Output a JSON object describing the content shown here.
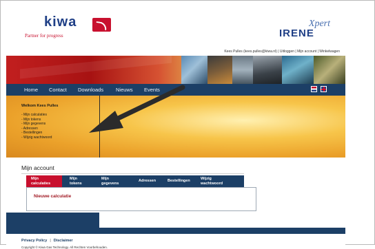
{
  "header": {
    "logo_text": "kiwa",
    "tagline": "Partner for progress",
    "product_superscript": "Xpert",
    "product_name": "IRENE",
    "user_bar": "Kees Pulles (kees.pulles@kiwa.nl) | Uitloggen | Mijn account | Winkelwagen"
  },
  "nav": {
    "items": [
      "Home",
      "Contact",
      "Downloads",
      "Nieuws",
      "Events"
    ],
    "flags": [
      "flag-nl-icon",
      "flag-uk-icon"
    ]
  },
  "sidebar": {
    "welcome": "Welkom Kees Pulles",
    "links": [
      "- Mijn calculaties",
      "- Mijn tokens",
      "- Mijn gegevens",
      "- Adressen",
      "- Bestellingen",
      "- Wijzig wachtwoord"
    ]
  },
  "account": {
    "title": "Mijn account",
    "tabs": [
      {
        "line1": "Mijn",
        "line2": "calculaties"
      },
      {
        "line1": "Mijn",
        "line2": "tokens"
      },
      {
        "line1": "Mijn",
        "line2": "gegevens"
      },
      {
        "line1": "Adressen",
        "line2": ""
      },
      {
        "line1": "Bestellingen",
        "line2": ""
      },
      {
        "line1": "Wijzig",
        "line2": "wachtwoord"
      }
    ],
    "active_tab": 0,
    "content_heading": "Nieuwe calculatie"
  },
  "footer": {
    "privacy": "Privacy Policy",
    "separator": "|",
    "disclaimer": "Disclaimer",
    "copyright": "Copyright © Kiwa Gas Technology. All Rechten Voorbehouden."
  },
  "colors": {
    "nav_blue": "#1c3f66",
    "brand_red": "#c8102e",
    "heading_red": "#a01822",
    "brand_blue": "#1f3f86"
  },
  "icons": [
    "kiwa-logo-icon",
    "arrow-icon",
    "flag-nl-icon",
    "flag-uk-icon"
  ]
}
